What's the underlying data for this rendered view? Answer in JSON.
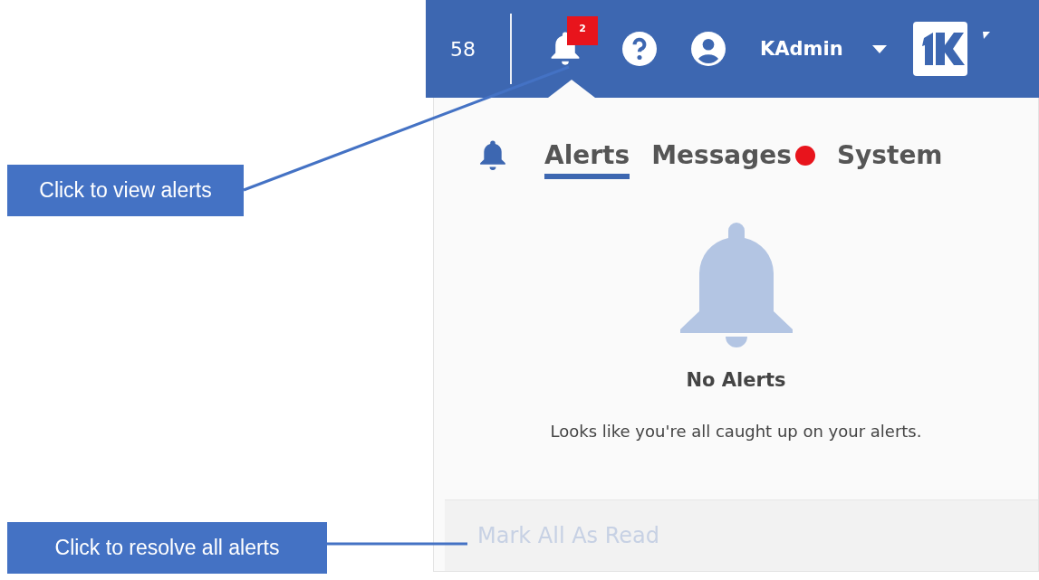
{
  "callouts": [
    {
      "text": "Click to view alerts",
      "kind": "header"
    },
    {
      "text": "Click to resolve all alerts",
      "kind": "footer"
    }
  ],
  "top_bar": {
    "count": "58",
    "notification_badge": "2",
    "username": "KAdmin"
  },
  "panel": {
    "tabs": [
      {
        "label": "Alerts",
        "selected": true,
        "unread": false
      },
      {
        "label": "Messages",
        "selected": false,
        "unread": true
      },
      {
        "label": "System",
        "selected": false,
        "unread": false
      }
    ],
    "empty_state": {
      "title": "No Alerts",
      "message": "Looks like you're all caught up on your alerts."
    },
    "footer_action": {
      "label": "Mark All As Read",
      "disabled": true
    }
  }
}
